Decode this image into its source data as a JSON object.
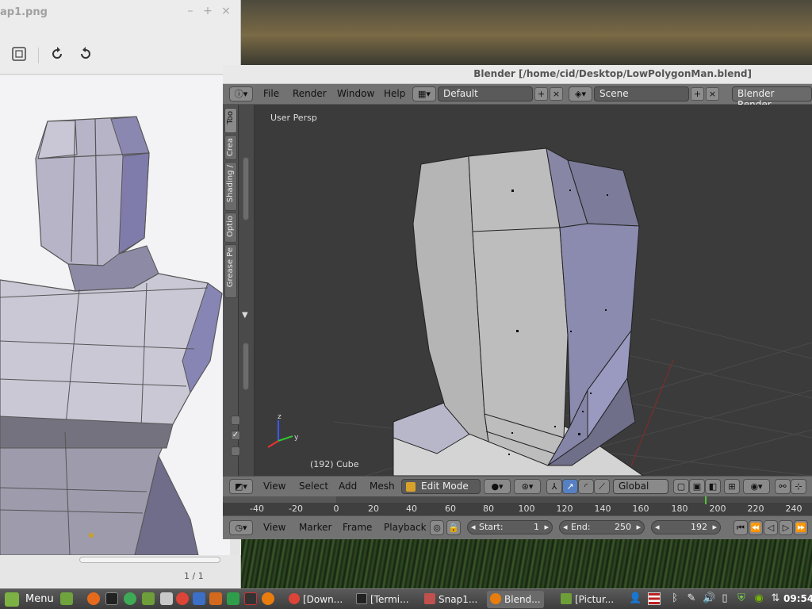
{
  "image_viewer": {
    "title": "ap1.png",
    "page_info": "1 / 1",
    "controls": {
      "minimize": "–",
      "maximize": "+",
      "close": "×"
    }
  },
  "blender": {
    "title": "Blender [/home/cid/Desktop/LowPolygonMan.blend]",
    "menu": {
      "file": "File",
      "render": "Render",
      "window": "Window",
      "help": "Help"
    },
    "layout": "Default",
    "scene": "Scene",
    "engine": "Blender Render",
    "tabs": [
      "Too",
      "Crea",
      "Shading /",
      "Optio",
      "Grease Pe"
    ],
    "viewport_label": "User Persp",
    "object_label": "(192) Cube",
    "view3d_header": {
      "view": "View",
      "select": "Select",
      "add": "Add",
      "mesh": "Mesh",
      "mode": "Edit Mode",
      "orientation": "Global"
    },
    "ruler_ticks": [
      "-40",
      "-20",
      "0",
      "20",
      "40",
      "60",
      "80",
      "100",
      "120",
      "140",
      "160",
      "180",
      "200",
      "220",
      "240"
    ],
    "timeline": {
      "view": "View",
      "marker": "Marker",
      "frame": "Frame",
      "playback": "Playback",
      "start_label": "Start:",
      "start_value": "1",
      "end_label": "End:",
      "end_value": "250",
      "current_frame": "192"
    }
  },
  "taskbar": {
    "menu": "Menu",
    "tasks": [
      "[Down...",
      "[Termi...",
      "Snap1...",
      "Blend...",
      "[Pictur..."
    ],
    "clock": "09:54"
  },
  "colors": {
    "blender_header": "#727272",
    "viewport_bg": "#3b3b3b",
    "mesh_light": "#bcbcbc",
    "mesh_blue": "#8a8ab5",
    "current_frame": "#55c23a"
  }
}
